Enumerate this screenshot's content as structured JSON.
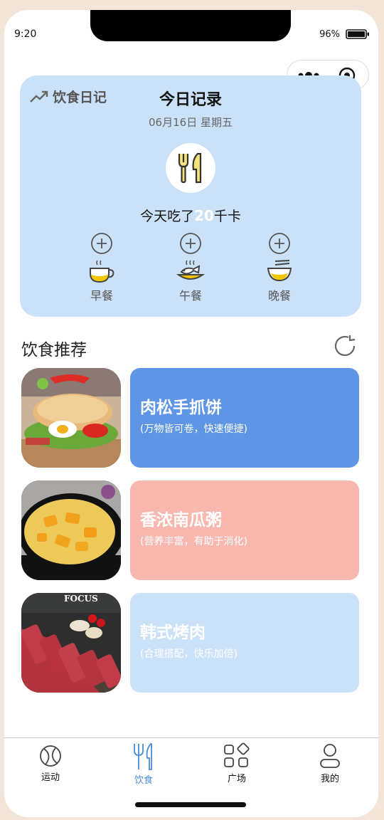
{
  "status_bar": {
    "time": "9:20",
    "battery": "96%"
  },
  "diary": {
    "tag": "饮食日记",
    "title": "今日记录",
    "date": "06月16日 星期五",
    "kcal_prefix": "今天吃了",
    "kcal_value": "20",
    "kcal_suffix": "千卡",
    "meals": [
      {
        "label": "早餐"
      },
      {
        "label": "午餐"
      },
      {
        "label": "晚餐"
      }
    ]
  },
  "recommend": {
    "heading": "饮食推荐",
    "items": [
      {
        "name": "肉松手抓饼",
        "desc": "(万物皆可卷，快速便捷)",
        "color": "#5e95e5"
      },
      {
        "name": "香浓南瓜粥",
        "desc": "(营养丰富，有助于消化)",
        "color": "#f8b8b0"
      },
      {
        "name": "韩式烤肉",
        "desc": "(合理搭配，快乐加倍)",
        "color": "#cbe1f8"
      }
    ],
    "image_caption": "FOCUS"
  },
  "tabbar": {
    "items": [
      {
        "label": "运动"
      },
      {
        "label": "饮食"
      },
      {
        "label": "广场"
      },
      {
        "label": "我的"
      }
    ],
    "active_color": "#4a8ad6"
  }
}
